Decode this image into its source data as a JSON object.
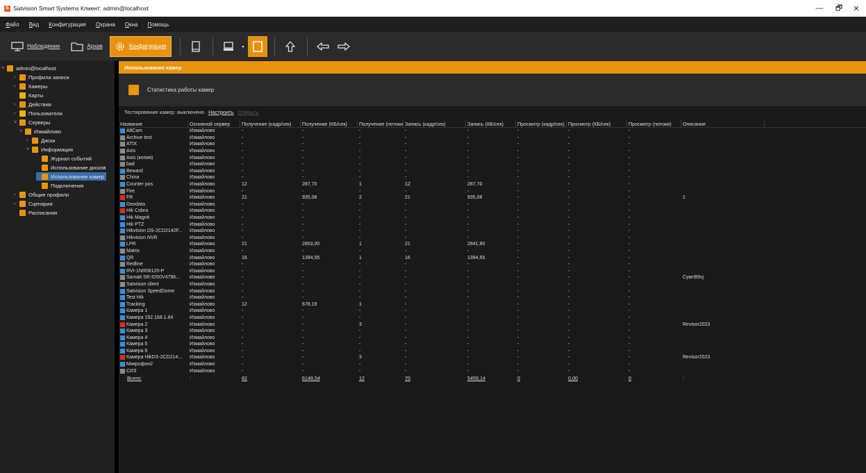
{
  "window": {
    "title": "Satvision Smart Systems Клиент: admin@localhost",
    "logo_glyph": "S",
    "minimize": "—",
    "maximize": "🗗",
    "close": "✕"
  },
  "menu": [
    {
      "label": "Файл"
    },
    {
      "label": "Вид"
    },
    {
      "label": "Конфигурация"
    },
    {
      "label": "Охрана"
    },
    {
      "label": "Окна"
    },
    {
      "label": "Помощь"
    }
  ],
  "toolbar": {
    "monitoring": "Наблюдение",
    "archive": "Архив",
    "configuration": "Конфигурация",
    "accent": "#e8910f"
  },
  "tree": [
    {
      "label": "admin@localhost",
      "arrow": "˅",
      "color": "#e8940c"
    },
    {
      "label": "Профили записи",
      "arrow": "›",
      "color": "#e8940c"
    },
    {
      "label": "Камеры",
      "arrow": "›",
      "color": "#e8940c"
    },
    {
      "label": "Карты",
      "arrow": "",
      "color": "#e8b40c"
    },
    {
      "label": "Действия",
      "arrow": "›",
      "color": "#e8940c"
    },
    {
      "label": "Пользователи",
      "arrow": "›",
      "color": "#e8b40c"
    },
    {
      "label": "Серверы",
      "arrow": "˅",
      "color": "#e8940c"
    },
    {
      "label": "Измайлово",
      "arrow": "˅",
      "color": "#e8940c"
    },
    {
      "label": "Диски",
      "arrow": "›",
      "color": "#e8940c"
    },
    {
      "label": "Информация",
      "arrow": "˅",
      "color": "#e8940c"
    },
    {
      "label": "Журнал событий",
      "arrow": "",
      "color": "#e8940c"
    },
    {
      "label": "Использование дисков",
      "arrow": "",
      "color": "#e8940c"
    },
    {
      "label": "Использование камер",
      "arrow": "",
      "color": "#e8940c"
    },
    {
      "label": "Подключения",
      "arrow": "",
      "color": "#e8940c"
    },
    {
      "label": "Общие профили",
      "arrow": "›",
      "color": "#e8940c"
    },
    {
      "label": "Сценарии",
      "arrow": "›",
      "color": "#e8940c"
    },
    {
      "label": "Расписания",
      "arrow": "",
      "color": "#e8940c"
    }
  ],
  "section_title": "Использование камер",
  "stat_label": "Статистика работы камер",
  "testing": {
    "status": "Тестирование камер: выключено",
    "configure": "Настроить",
    "disabled_link": "Открыть"
  },
  "columns": [
    "Название",
    "Основной сервер",
    "Получение (кадр/сек)",
    "Получение (КБ/сек)",
    "Получение (потоки)",
    "Запись (кадр/сек)",
    "Запись (КБ/сек)",
    "Просмотр (кадр/сек)",
    "Просмотр (КБ/сек)",
    "Просмотр (потоки)",
    "Описание"
  ],
  "rows": [
    {
      "icon": "blue",
      "name": "AltCam",
      "server": "Измайлово",
      "c": [
        "-",
        "-",
        "-",
        "-",
        "-",
        "-",
        "-",
        "-",
        ""
      ]
    },
    {
      "icon": "gray",
      "name": "Archive test",
      "server": "Измайлово",
      "c": [
        "-",
        "-",
        "-",
        "-",
        "-",
        "-",
        "-",
        "-",
        ""
      ]
    },
    {
      "icon": "gray",
      "name": "ATIX",
      "server": "Измайлово",
      "c": [
        "-",
        "-",
        "-",
        "-",
        "-",
        "-",
        "-",
        "-",
        ""
      ]
    },
    {
      "icon": "gray",
      "name": "Axis",
      "server": "Измайлово",
      "c": [
        "-",
        "-",
        "-",
        "-",
        "-",
        "-",
        "-",
        "-",
        ""
      ]
    },
    {
      "icon": "gray",
      "name": "Axis (копия)",
      "server": "Измайлово",
      "c": [
        "-",
        "-",
        "-",
        "-",
        "-",
        "-",
        "-",
        "-",
        ""
      ]
    },
    {
      "icon": "gray",
      "name": "bad",
      "server": "Измайлово",
      "c": [
        "-",
        "-",
        "-",
        "-",
        "-",
        "-",
        "-",
        "-",
        ""
      ]
    },
    {
      "icon": "blue",
      "name": "Beward",
      "server": "Измайлово",
      "c": [
        "-",
        "-",
        "-",
        "-",
        "-",
        "-",
        "-",
        "-",
        ""
      ]
    },
    {
      "icon": "gray",
      "name": "China",
      "server": "Измайлово",
      "c": [
        "-",
        "-",
        "-",
        "-",
        "-",
        "-",
        "-",
        "-",
        ""
      ]
    },
    {
      "icon": "blue",
      "name": "Counter pos",
      "server": "Измайлово",
      "c": [
        "12",
        "287,70",
        "1",
        "12",
        "287,70",
        "-",
        "-",
        "-",
        ""
      ]
    },
    {
      "icon": "gray",
      "name": "Fire",
      "server": "Измайлово",
      "c": [
        "-",
        "-",
        "-",
        "-",
        "-",
        "-",
        "-",
        "-",
        ""
      ]
    },
    {
      "icon": "red",
      "name": "FR",
      "server": "Измайлово",
      "c": [
        "21",
        "935,08",
        "2",
        "21",
        "935,08",
        "-",
        "-",
        "-",
        "1"
      ]
    },
    {
      "icon": "blue",
      "name": "Geodata",
      "server": "Измайлово",
      "c": [
        "-",
        "-",
        "-",
        "-",
        "-",
        "-",
        "-",
        "-",
        ""
      ]
    },
    {
      "icon": "red",
      "name": "Hik Cobra",
      "server": "Измайлово",
      "c": [
        "-",
        "-",
        "-",
        "-",
        "-",
        "-",
        "-",
        "-",
        ""
      ]
    },
    {
      "icon": "blue",
      "name": "Hik Magnit",
      "server": "Измайлово",
      "c": [
        "-",
        "-",
        "-",
        "-",
        "-",
        "-",
        "-",
        "-",
        ""
      ]
    },
    {
      "icon": "blue",
      "name": "Hik PTZ",
      "server": "Измайлово",
      "c": [
        "-",
        "-",
        "-",
        "-",
        "-",
        "-",
        "-",
        "-",
        ""
      ]
    },
    {
      "icon": "blue",
      "name": "Hikvision DS-2CD2142F...",
      "server": "Измайлово",
      "c": [
        "-",
        "-",
        "-",
        "-",
        "-",
        "-",
        "-",
        "-",
        ""
      ]
    },
    {
      "icon": "gray",
      "name": "Hikvision NVR",
      "server": "Измайлово",
      "c": [
        "-",
        "-",
        "-",
        "-",
        "-",
        "-",
        "-",
        "-",
        ""
      ]
    },
    {
      "icon": "blue",
      "name": "LPR",
      "server": "Измайлово",
      "c": [
        "21",
        "2853,00",
        "1",
        "21",
        "2841,80",
        "-",
        "-",
        "-",
        ""
      ]
    },
    {
      "icon": "gray",
      "name": "Matrix",
      "server": "Измайлово",
      "c": [
        "-",
        "-",
        "-",
        "-",
        "-",
        "-",
        "-",
        "-",
        ""
      ]
    },
    {
      "icon": "blue",
      "name": "QR",
      "server": "Измайлово",
      "c": [
        "16",
        "1394,55",
        "1",
        "16",
        "1394,55",
        "-",
        "-",
        "-",
        ""
      ]
    },
    {
      "icon": "gray",
      "name": "Redline",
      "server": "Измайлово",
      "c": [
        "-",
        "-",
        "-",
        "-",
        "-",
        "-",
        "-",
        "-",
        ""
      ]
    },
    {
      "icon": "blue",
      "name": "RVI-1NR08120-P",
      "server": "Измайлово",
      "c": [
        "-",
        "-",
        "-",
        "-",
        "-",
        "-",
        "-",
        "-",
        ""
      ]
    },
    {
      "icon": "gray",
      "name": "Samatt SR-ID50V4796...",
      "server": "Измайлово",
      "c": [
        "-",
        "-",
        "-",
        "-",
        "-",
        "-",
        "-",
        "-",
        "СумтВ9vj"
      ]
    },
    {
      "icon": "gray",
      "name": "Satvision client",
      "server": "Измайлово",
      "c": [
        "-",
        "-",
        "-",
        "-",
        "-",
        "-",
        "-",
        "-",
        ""
      ]
    },
    {
      "icon": "blue",
      "name": "Satvision SpeedDome",
      "server": "Измайлово",
      "c": [
        "-",
        "-",
        "-",
        "-",
        "-",
        "-",
        "-",
        "-",
        ""
      ]
    },
    {
      "icon": "blue",
      "name": "Test Hik",
      "server": "Измайлово",
      "c": [
        "-",
        "-",
        "-",
        "-",
        "-",
        "-",
        "-",
        "-",
        ""
      ]
    },
    {
      "icon": "blue",
      "name": "Tracking",
      "server": "Измайлово",
      "c": [
        "12",
        "678,19",
        "1",
        "-",
        "-",
        "-",
        "-",
        "-",
        ""
      ]
    },
    {
      "icon": "blue",
      "name": "Камера 1",
      "server": "Измайлово",
      "c": [
        "-",
        "-",
        "-",
        "-",
        "-",
        "-",
        "-",
        "-",
        ""
      ]
    },
    {
      "icon": "blue",
      "name": "Камера 192.168.1.84",
      "server": "Измайлово",
      "c": [
        "-",
        "-",
        "-",
        "-",
        "-",
        "-",
        "-",
        "-",
        ""
      ]
    },
    {
      "icon": "red",
      "name": "Камера 2",
      "server": "Измайлово",
      "c": [
        "-",
        "-",
        "3",
        "-",
        "-",
        "-",
        "-",
        "-",
        "Revisor2023"
      ]
    },
    {
      "icon": "blue",
      "name": "Камера 3",
      "server": "Измайлово",
      "c": [
        "-",
        "-",
        "-",
        "-",
        "-",
        "-",
        "-",
        "-",
        ""
      ]
    },
    {
      "icon": "blue",
      "name": "Камера 4",
      "server": "Измайлово",
      "c": [
        "-",
        "-",
        "-",
        "-",
        "-",
        "-",
        "-",
        "-",
        ""
      ]
    },
    {
      "icon": "blue",
      "name": "Камера 5",
      "server": "Измайлово",
      "c": [
        "-",
        "-",
        "-",
        "-",
        "-",
        "-",
        "-",
        "-",
        ""
      ]
    },
    {
      "icon": "blue",
      "name": "Камера 6",
      "server": "Измайлово",
      "c": [
        "-",
        "-",
        "-",
        "-",
        "-",
        "-",
        "-",
        "-",
        ""
      ]
    },
    {
      "icon": "red",
      "name": "Камера HikDS-2CD214...",
      "server": "Измайлово",
      "c": [
        "-",
        "-",
        "3",
        "-",
        "-",
        "-",
        "-",
        "-",
        "Revisor2023"
      ]
    },
    {
      "icon": "blue",
      "name": "Микрофон2",
      "server": "Измайлово",
      "c": [
        "-",
        "-",
        "-",
        "-",
        "-",
        "-",
        "-",
        "-",
        ""
      ]
    },
    {
      "icon": "gray",
      "name": "СИЗ",
      "server": "Измайлово",
      "c": [
        "-",
        "-",
        "-",
        "-",
        "-",
        "-",
        "-",
        "-",
        ""
      ]
    }
  ],
  "totals": {
    "label": "Всего:",
    "server": ":",
    "c": [
      "82",
      "6148,54",
      "12",
      "70",
      "5459,14",
      "0",
      "0,00",
      "0",
      ":"
    ]
  },
  "icon_colors": {
    "blue": "#3b8fd6",
    "gray": "#8a8a8a",
    "red": "#d8301e"
  }
}
